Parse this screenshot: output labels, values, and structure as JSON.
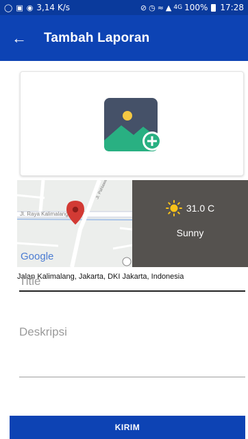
{
  "status_bar": {
    "network_speed": "3,14 K/s",
    "network_type": "4G",
    "battery": "100%",
    "time": "17:28"
  },
  "app_bar": {
    "title": "Tambah Laporan",
    "back_icon": "arrow-back-icon"
  },
  "photo": {
    "icon": "add-image-icon"
  },
  "map": {
    "street_label": "Jl. Raya Kalimalang",
    "road_label": "Jl. Pahlawan",
    "logo": "Google",
    "pin_icon": "location-pin-icon"
  },
  "weather": {
    "icon": "sun-icon",
    "temperature": "31.0 C",
    "condition": "Sunny"
  },
  "address": "Jalan Kalimalang, Jakarta, DKI Jakarta, Indonesia",
  "form": {
    "title_placeholder": "Title",
    "title_value": "",
    "description_placeholder": "Deskripsi",
    "description_value": ""
  },
  "submit_label": "KIRIM",
  "colors": {
    "primary": "#0d43b4",
    "status_bar": "#0a3a9c",
    "weather_bg": "#55524f",
    "pin": "#c9302c"
  }
}
